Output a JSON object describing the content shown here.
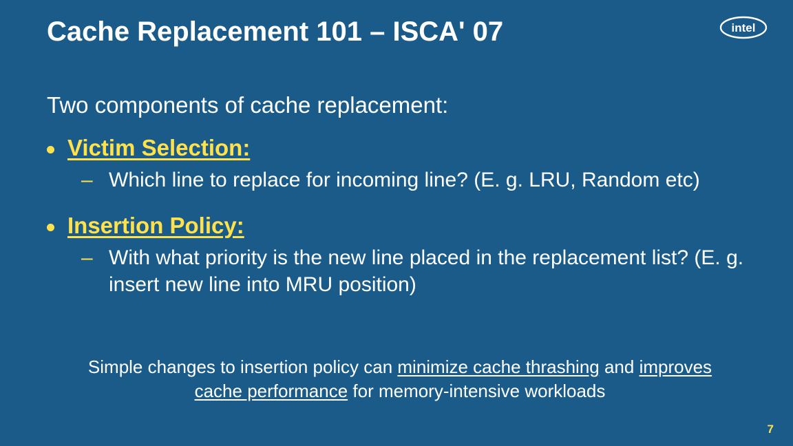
{
  "title": "Cache Replacement 101 – ISCA' 07",
  "logo_label": "intel",
  "intro": "Two components of cache replacement:",
  "bullets": [
    {
      "heading": "Victim Selection:",
      "sub": "Which line to replace for incoming line? (E. g. LRU, Random etc)"
    },
    {
      "heading": "Insertion Policy:",
      "sub": "With what priority is the new line placed in the replacement list? (E. g. insert new line into MRU position)"
    }
  ],
  "summary": {
    "pre": "Simple changes to insertion policy can ",
    "u1": "minimize cache thrashing",
    "mid": " and ",
    "u2": "improves cache performance",
    "post": " for memory-intensive workloads"
  },
  "page_number": "7"
}
